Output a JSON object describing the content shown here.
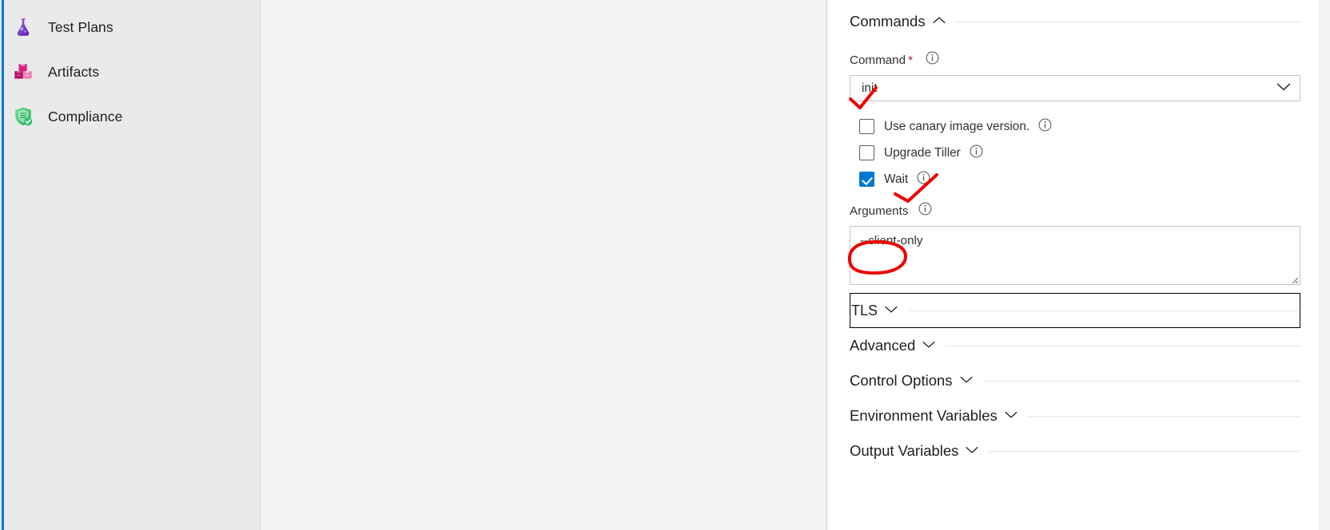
{
  "theme": {
    "accent": "#0078d4",
    "sidebar_bg": "#eaeaea",
    "mid_pane_bg": "#f3f3f3",
    "pane_bg": "#ffffff",
    "required_star": "#a4262c",
    "annotation_ink": "#ee0000",
    "border": "#c8c6c4"
  },
  "sidebar": {
    "items": [
      {
        "label": "Test Plans",
        "icon": "beaker-icon"
      },
      {
        "label": "Artifacts",
        "icon": "packages-icon"
      },
      {
        "label": "Compliance",
        "icon": "shield-check-icon"
      }
    ]
  },
  "form": {
    "commands_section": {
      "title": "Commands",
      "chevron": "chevron-up-icon",
      "expanded": true
    },
    "command_field": {
      "label": "Command",
      "required_marker": "*",
      "info_icon": "info-icon",
      "value": "init",
      "placeholder": "init",
      "chevron": "chevron-down-icon",
      "options": [
        "init"
      ]
    },
    "checkboxes": [
      {
        "label": "Use canary image version.",
        "checked": false,
        "info_icon": "info-icon"
      },
      {
        "label": "Upgrade Tiller",
        "checked": false,
        "info_icon": "info-icon"
      },
      {
        "label": "Wait",
        "checked": true,
        "info_icon": "info-icon"
      }
    ],
    "arguments_field": {
      "label": "Arguments",
      "info_icon": "info-icon",
      "value": "--client-only",
      "placeholder": ""
    },
    "sections": [
      {
        "title": "TLS",
        "chevron": "chevron-down-icon",
        "expanded": false,
        "focused": true
      },
      {
        "title": "Advanced",
        "chevron": "chevron-down-icon",
        "expanded": false,
        "focused": false
      },
      {
        "title": "Control Options",
        "chevron": "chevron-down-icon",
        "expanded": false,
        "focused": false
      },
      {
        "title": "Environment Variables",
        "chevron": "chevron-down-icon",
        "expanded": false,
        "focused": false
      },
      {
        "title": "Output Variables",
        "chevron": "chevron-down-icon",
        "expanded": false,
        "focused": false
      }
    ]
  },
  "annotations": [
    {
      "name": "checkmark-on-command-value",
      "shape": "check-stroke"
    },
    {
      "name": "checkmark-pointing-to-wait",
      "shape": "check-stroke"
    },
    {
      "name": "circle-around-arguments-value",
      "shape": "ellipse-stroke"
    }
  ]
}
